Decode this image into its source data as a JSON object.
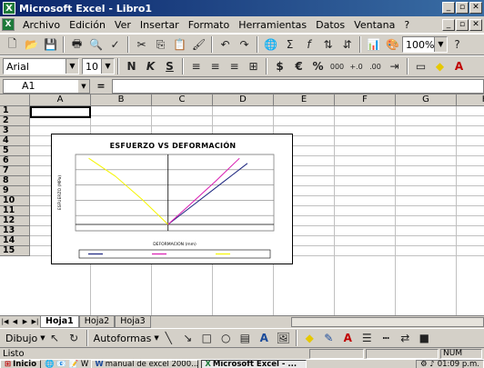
{
  "window": {
    "title": "Microsoft Excel - Libro1"
  },
  "menu": [
    "Archivo",
    "Edición",
    "Ver",
    "Insertar",
    "Formato",
    "Herramientas",
    "Datos",
    "Ventana",
    "?"
  ],
  "standard_toolbar": {
    "zoom": "100%"
  },
  "format_toolbar": {
    "font_name": "Arial",
    "font_size": "10",
    "bold": "N",
    "italic": "K",
    "underline": "S"
  },
  "formula_bar": {
    "name_box": "A1",
    "fx_symbol": "="
  },
  "columns": [
    "A",
    "B",
    "C",
    "D",
    "E",
    "F",
    "G",
    "H"
  ],
  "rows": [
    "1",
    "2",
    "3",
    "4",
    "5",
    "6",
    "7",
    "8",
    "9",
    "10",
    "11",
    "12",
    "13",
    "14",
    "15"
  ],
  "chart_data": {
    "type": "line",
    "title": "ESFUERZO VS DEFORMACIÓN",
    "xlabel": "DEFORMACION (mm)",
    "ylabel": "ESFUERZO (MPa)",
    "grid": true,
    "series": [
      {
        "color": "#1a237e",
        "x": [
          0,
          1,
          2,
          3
        ],
        "y": [
          0,
          1.6,
          3.2,
          4.8
        ]
      },
      {
        "color": "#d81bb0",
        "x": [
          0,
          0.9,
          1.8,
          2.7
        ],
        "y": [
          0,
          1.7,
          3.4,
          5.2
        ]
      },
      {
        "color": "#f5f500",
        "x": [
          0,
          -1,
          -2,
          -3
        ],
        "y": [
          0,
          2.0,
          3.8,
          5.2
        ]
      }
    ]
  },
  "sheets": [
    "Hoja1",
    "Hoja2",
    "Hoja3"
  ],
  "draw_toolbar": {
    "draw_label": "Dibujo",
    "autoshapes_label": "Autoformas"
  },
  "status": {
    "left": "Listo",
    "num": "NUM"
  },
  "taskbar": {
    "start": "Inicio",
    "items": [
      "manual de excel 2000...",
      "Microsoft Excel - ..."
    ],
    "clock": "01:09 p.m."
  },
  "colors": {
    "title_bar": "#0a246a",
    "excel_green": "#1d7a3a"
  }
}
